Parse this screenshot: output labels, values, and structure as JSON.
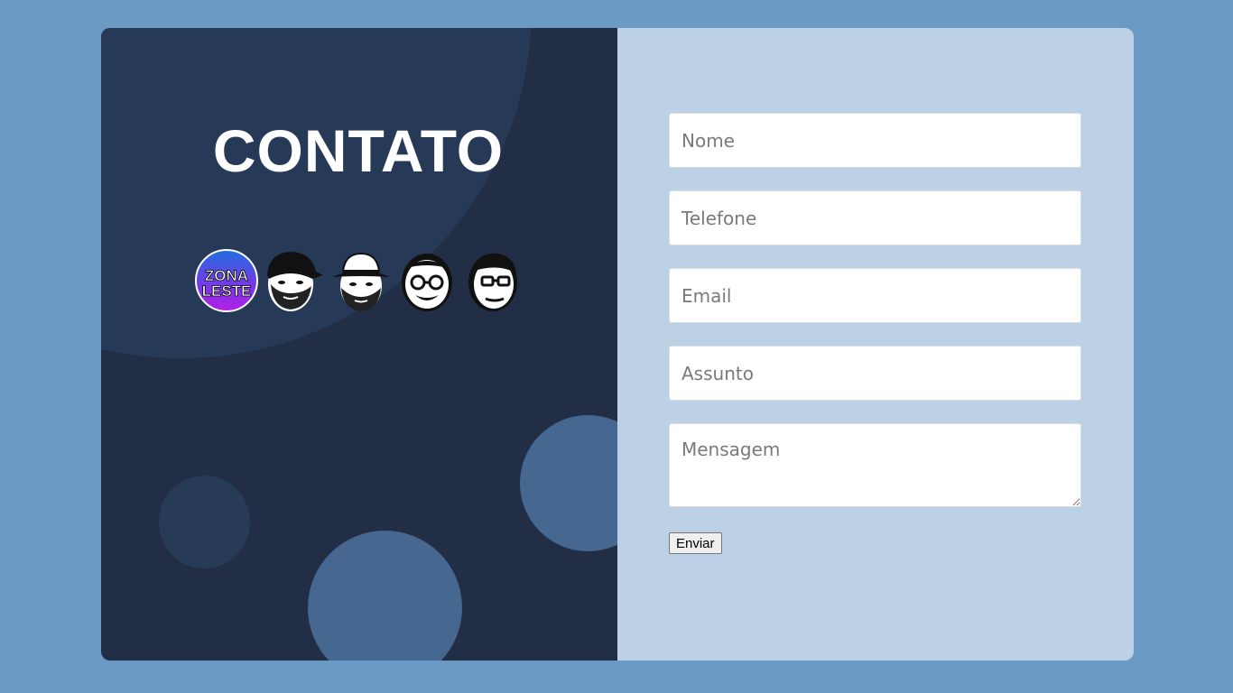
{
  "contact": {
    "title": "CONTATO",
    "logo_text_line1": "ZONA",
    "logo_text_line2": "LESTE"
  },
  "avatars": [
    {
      "icon": "zona-leste-logo-icon"
    },
    {
      "icon": "man-with-cap-face-icon"
    },
    {
      "icon": "man-with-hat-face-icon"
    },
    {
      "icon": "man-with-glasses-smiling-face-icon"
    },
    {
      "icon": "man-with-glasses-face-icon"
    }
  ],
  "form": {
    "name_placeholder": "Nome",
    "phone_placeholder": "Telefone",
    "email_placeholder": "Email",
    "subject_placeholder": "Assunto",
    "message_placeholder": "Mensagem",
    "submit_label": "Enviar"
  },
  "colors": {
    "page_background": "#6b9ac4",
    "left_panel": "#222e45",
    "right_panel": "#bdd1e6",
    "accent_circle": "#456790"
  }
}
